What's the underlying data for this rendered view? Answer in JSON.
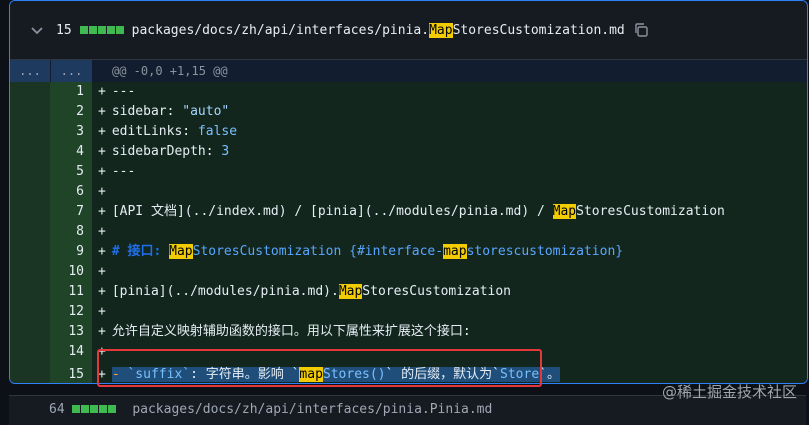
{
  "file": {
    "change_count": "15",
    "path_prefix": "packages/docs/zh/api/interfaces/pinia.",
    "path_highlight": "Map",
    "path_suffix": "StoresCustomization.md"
  },
  "hunk": {
    "expand_up": "...",
    "expand_down": "...",
    "header": "@@ -0,0 +1,15 @@"
  },
  "lines": [
    {
      "n": "1",
      "text": "---"
    },
    {
      "n": "2",
      "key": "sidebar: ",
      "val": "\"auto\""
    },
    {
      "n": "3",
      "key": "editLinks: ",
      "val": "false"
    },
    {
      "n": "4",
      "key": "sidebarDepth: ",
      "val": "3"
    },
    {
      "n": "5",
      "text": "---"
    },
    {
      "n": "6",
      "text": ""
    },
    {
      "n": "7",
      "pre": "[API 文档](../index.md) / [pinia](../modules/pinia.md) / ",
      "hl": "Map",
      "post": "StoresCustomization"
    },
    {
      "n": "8",
      "text": ""
    },
    {
      "n": "9",
      "hpre": "# 接口: ",
      "hl": "Map",
      "hmid": "StoresCustomization {#interface-",
      "hl2": "map",
      "hpost": "storescustomization}"
    },
    {
      "n": "10",
      "text": ""
    },
    {
      "n": "11",
      "pre": "[pinia](../modules/pinia.md).",
      "hl": "Map",
      "post": "StoresCustomization"
    },
    {
      "n": "12",
      "text": ""
    },
    {
      "n": "13",
      "text": "允许自定义映射辅助函数的接口。用以下属性来扩展这个接口:"
    },
    {
      "n": "14",
      "text": ""
    },
    {
      "n": "15",
      "dash": "- ",
      "t1": "`suffix`",
      "m1": ": 字符串。影响 `",
      "hl": "map",
      "t2": "Stores()",
      "m2": "` 的后缀，默认为`",
      "t3": "Store",
      "m3": "`。"
    }
  ],
  "next_file": {
    "change_count": "64",
    "path": "packages/docs/zh/api/interfaces/pinia.Pinia.md"
  },
  "watermark": "@稀土掘金技术社区"
}
